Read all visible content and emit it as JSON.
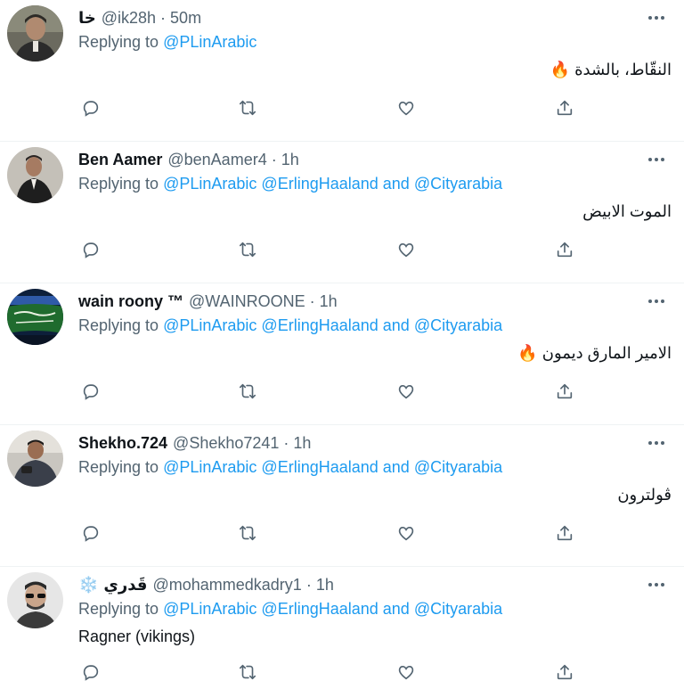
{
  "tweets": [
    {
      "name": "خا",
      "name_badge": "",
      "handle": "@ik28h",
      "time": "50m",
      "replying_label": "Replying to",
      "mentions": [
        "@PLinArabic"
      ],
      "mentions_and": "",
      "mention_last": "",
      "text": "النقّاط، بالشدة",
      "text_emoji": "🔥",
      "text_dir": "rtl",
      "avatar": "portrait-man-dark"
    },
    {
      "name": "Ben Aamer",
      "name_badge": "",
      "handle": "@benAamer4",
      "time": "1h",
      "replying_label": "Replying to",
      "mentions": [
        "@PLinArabic",
        "@ErlingHaaland"
      ],
      "mentions_and": "and",
      "mention_last": "@Cityarabia",
      "text": "الموت الابيض",
      "text_emoji": "",
      "text_dir": "rtl",
      "avatar": "portrait-man-suit"
    },
    {
      "name": "wain roony ™",
      "name_badge": "",
      "handle": "@WAINROONE",
      "time": "1h",
      "replying_label": "Replying to",
      "mentions": [
        "@PLinArabic",
        "@ErlingHaaland"
      ],
      "mentions_and": "and",
      "mention_last": "@Cityarabia",
      "text": "الامير المارق ديمون",
      "text_emoji": "🔥",
      "text_dir": "rtl",
      "avatar": "flag-green"
    },
    {
      "name": "Shekho.724",
      "name_badge": "",
      "handle": "@Shekho7241",
      "time": "1h",
      "replying_label": "Replying to",
      "mentions": [
        "@PLinArabic",
        "@ErlingHaaland"
      ],
      "mentions_and": "and",
      "mention_last": "@Cityarabia",
      "text": "ڤولترون",
      "text_emoji": "",
      "text_dir": "rtl",
      "avatar": "portrait-man-phone"
    },
    {
      "name": "قَدري",
      "name_badge": "❄️",
      "handle": "@mohammedkadry1",
      "time": "1h",
      "replying_label": "Replying to",
      "mentions": [
        "@PLinArabic",
        "@ErlingHaaland"
      ],
      "mentions_and": "and",
      "mention_last": "@Cityarabia",
      "text": "Ragner (vikings)",
      "text_emoji": "",
      "text_dir": "ltr",
      "avatar": "portrait-man-sunglasses"
    }
  ],
  "separator": "·",
  "icons": {
    "reply": "reply-icon",
    "retweet": "retweet-icon",
    "like": "like-icon",
    "share": "share-icon",
    "more": "more-icon"
  },
  "colors": {
    "link": "#1d9bf0",
    "secondary": "#536471",
    "text": "#0f1419",
    "divider": "#eff3f4"
  }
}
